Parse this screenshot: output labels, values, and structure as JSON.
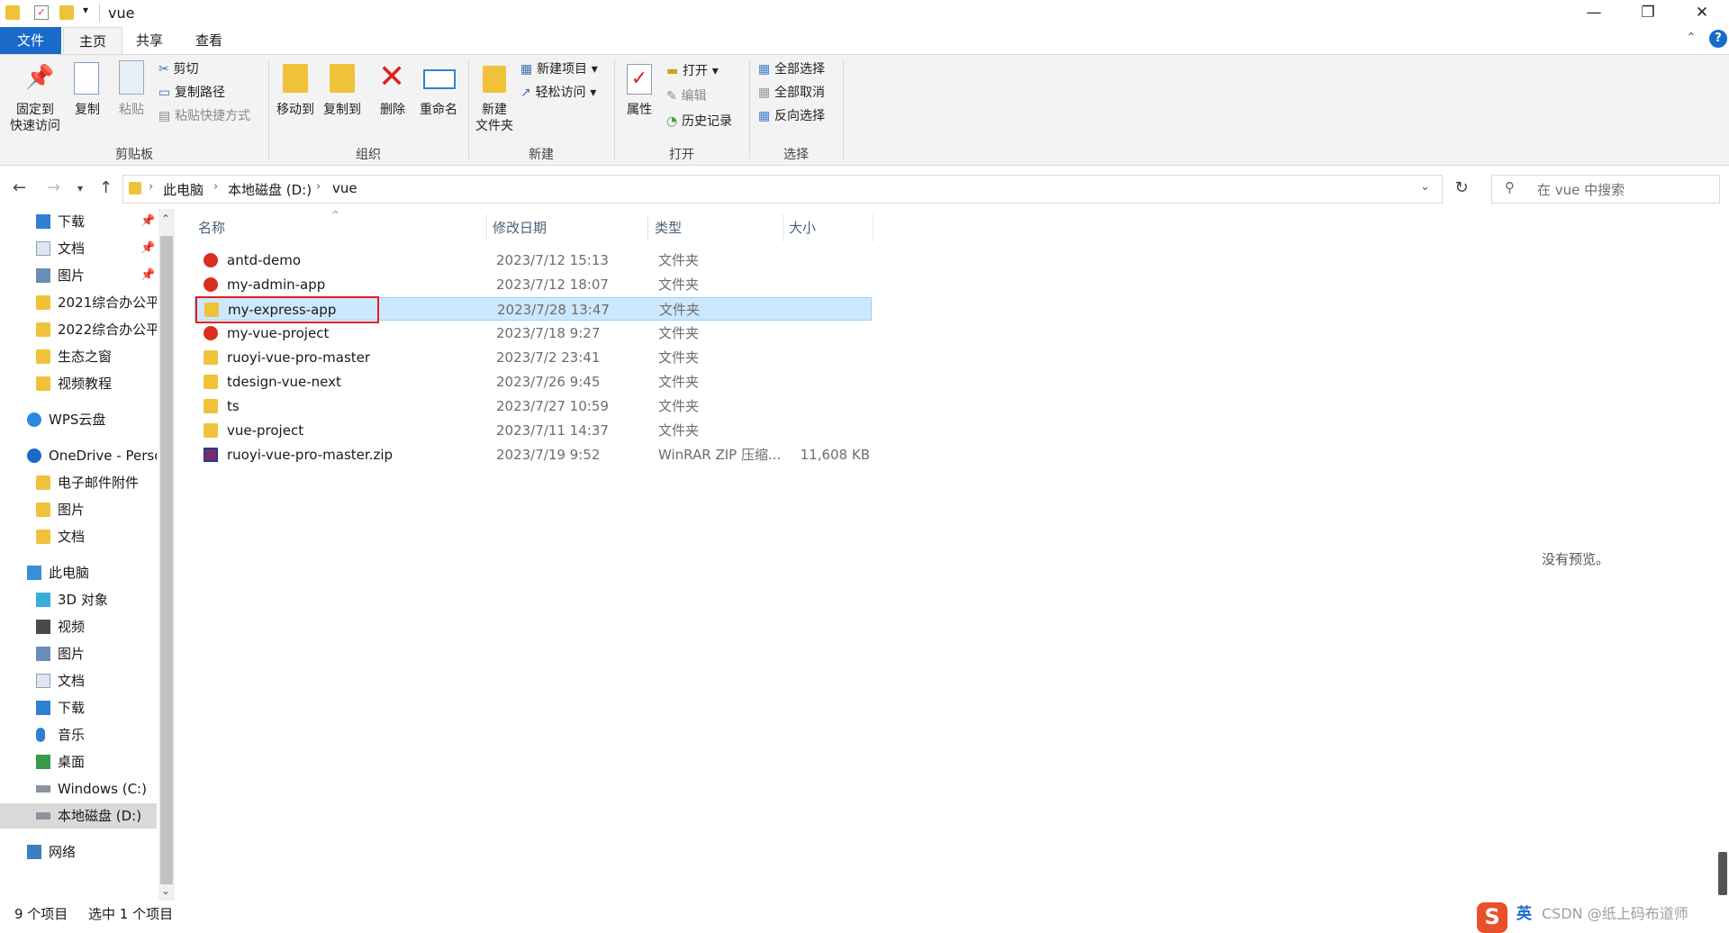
{
  "window": {
    "title": "vue",
    "minimize": "—",
    "restore": "❐",
    "close": "✕"
  },
  "tabs": {
    "file": "文件",
    "home": "主页",
    "share": "共享",
    "view": "查看"
  },
  "ribbon": {
    "clipboard": {
      "pin": "固定到\n快速访问",
      "copy": "复制",
      "paste": "粘贴",
      "cut": "剪切",
      "copy_path": "复制路径",
      "paste_shortcut": "粘贴快捷方式",
      "label": "剪贴板"
    },
    "organize": {
      "move_to": "移动到",
      "copy_to": "复制到",
      "delete": "删除",
      "rename": "重命名",
      "label": "组织"
    },
    "new": {
      "new_folder": "新建\n文件夹",
      "new_item": "新建项目",
      "easy_access": "轻松访问",
      "label": "新建"
    },
    "open": {
      "properties": "属性",
      "open": "打开",
      "edit": "编辑",
      "history": "历史记录",
      "label": "打开"
    },
    "select": {
      "select_all": "全部选择",
      "select_none": "全部取消",
      "invert": "反向选择",
      "label": "选择"
    }
  },
  "address": {
    "crumbs": [
      "此电脑",
      "本地磁盘 (D:)",
      "vue"
    ],
    "search_placeholder": "在 vue 中搜索"
  },
  "sidebar": {
    "items": [
      {
        "label": "下载",
        "icon": "download-icon",
        "pinned": true
      },
      {
        "label": "文档",
        "icon": "document-icon",
        "pinned": true
      },
      {
        "label": "图片",
        "icon": "picture-icon",
        "pinned": true
      },
      {
        "label": "2021综合办公平",
        "icon": "folder-icon"
      },
      {
        "label": "2022综合办公平",
        "icon": "folder-icon"
      },
      {
        "label": "生态之窗",
        "icon": "folder-icon"
      },
      {
        "label": "视频教程",
        "icon": "folder-icon"
      },
      {
        "label": "WPS云盘",
        "icon": "cloud-icon"
      },
      {
        "label": "OneDrive - Perso",
        "icon": "onedrive-icon"
      },
      {
        "label": "电子邮件附件",
        "icon": "folder-icon"
      },
      {
        "label": "图片",
        "icon": "folder-icon"
      },
      {
        "label": "文档",
        "icon": "folder-icon"
      },
      {
        "label": "此电脑",
        "icon": "computer-icon"
      },
      {
        "label": "3D 对象",
        "icon": "3d-objects-icon"
      },
      {
        "label": "视频",
        "icon": "video-icon"
      },
      {
        "label": "图片",
        "icon": "picture-icon"
      },
      {
        "label": "文档",
        "icon": "document-icon"
      },
      {
        "label": "下载",
        "icon": "download-icon"
      },
      {
        "label": "音乐",
        "icon": "music-icon"
      },
      {
        "label": "桌面",
        "icon": "desktop-icon"
      },
      {
        "label": "Windows (C:)",
        "icon": "drive-icon"
      },
      {
        "label": "本地磁盘 (D:)",
        "icon": "drive-icon",
        "selected": true
      },
      {
        "label": "网络",
        "icon": "network-icon"
      }
    ]
  },
  "columns": {
    "name": "名称",
    "date": "修改日期",
    "type": "类型",
    "size": "大小"
  },
  "files": [
    {
      "name": "antd-demo",
      "date": "2023/7/12 15:13",
      "type": "文件夹",
      "size": "",
      "icon": "folder-error-icon"
    },
    {
      "name": "my-admin-app",
      "date": "2023/7/12 18:07",
      "type": "文件夹",
      "size": "",
      "icon": "folder-error-icon"
    },
    {
      "name": "my-express-app",
      "date": "2023/7/28 13:47",
      "type": "文件夹",
      "size": "",
      "icon": "folder-icon",
      "selected": true
    },
    {
      "name": "my-vue-project",
      "date": "2023/7/18 9:27",
      "type": "文件夹",
      "size": "",
      "icon": "folder-error-icon"
    },
    {
      "name": "ruoyi-vue-pro-master",
      "date": "2023/7/2 23:41",
      "type": "文件夹",
      "size": "",
      "icon": "folder-icon"
    },
    {
      "name": "tdesign-vue-next",
      "date": "2023/7/26 9:45",
      "type": "文件夹",
      "size": "",
      "icon": "folder-icon"
    },
    {
      "name": "ts",
      "date": "2023/7/27 10:59",
      "type": "文件夹",
      "size": "",
      "icon": "folder-icon"
    },
    {
      "name": "vue-project",
      "date": "2023/7/11 14:37",
      "type": "文件夹",
      "size": "",
      "icon": "folder-icon"
    },
    {
      "name": "ruoyi-vue-pro-master.zip",
      "date": "2023/7/19 9:52",
      "type": "WinRAR ZIP 压缩...",
      "size": "11,608 KB",
      "icon": "winrar-icon"
    }
  ],
  "preview": {
    "text": "没有预览。"
  },
  "status": {
    "count": "9 个项目",
    "selected": "选中 1 个项目"
  },
  "tray": {
    "ime": "英",
    "watermark": "CSDN @纸上码布道师"
  },
  "colors": {
    "accent": "#1a6bc8",
    "selection": "#cce8ff",
    "highlight_box": "#e02020"
  }
}
